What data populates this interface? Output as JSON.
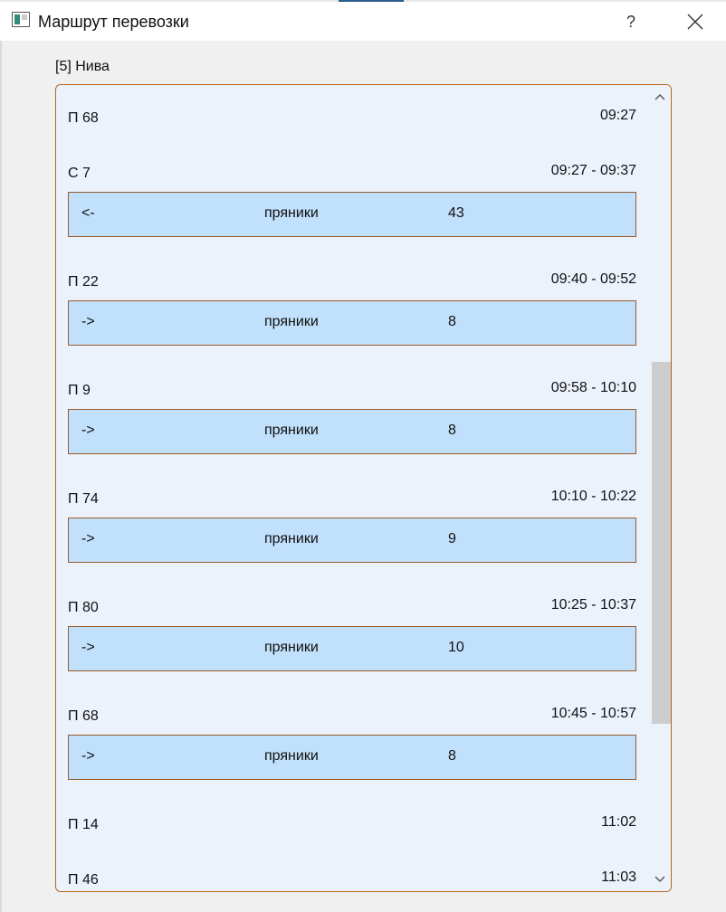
{
  "window": {
    "title": "Маршрут перевозки",
    "help_label": "?"
  },
  "vehicle_label": "[5] Нива",
  "stops": [
    {
      "name": "П 68",
      "time": "09:27"
    },
    {
      "name": "С 7",
      "time": "09:27 - 09:37",
      "operation": {
        "direction": "<-",
        "cargo": "пряники",
        "quantity": "43"
      }
    },
    {
      "name": "П 22",
      "time": "09:40 - 09:52",
      "operation": {
        "direction": "->",
        "cargo": "пряники",
        "quantity": "8"
      }
    },
    {
      "name": "П 9",
      "time": "09:58 - 10:10",
      "operation": {
        "direction": "->",
        "cargo": "пряники",
        "quantity": "8"
      }
    },
    {
      "name": "П 74",
      "time": "10:10 - 10:22",
      "operation": {
        "direction": "->",
        "cargo": "пряники",
        "quantity": "9"
      }
    },
    {
      "name": "П 80",
      "time": "10:25 - 10:37",
      "operation": {
        "direction": "->",
        "cargo": "пряники",
        "quantity": "10"
      }
    },
    {
      "name": "П 68",
      "time": "10:45 - 10:57",
      "operation": {
        "direction": "->",
        "cargo": "пряники",
        "quantity": "8"
      }
    },
    {
      "name": "П 14",
      "time": "11:02"
    },
    {
      "name": "П 46",
      "time": "11:03"
    }
  ],
  "colors": {
    "frame_border": "#b5651d",
    "list_background": "#ecf2fb",
    "operation_background": "#c1e0fb",
    "scroll_thumb": "#cdcdcd"
  },
  "icons": {
    "app": "app-window-icon",
    "close": "close-icon",
    "scroll_up": "chevron-up-icon",
    "scroll_down": "chevron-down-icon"
  }
}
